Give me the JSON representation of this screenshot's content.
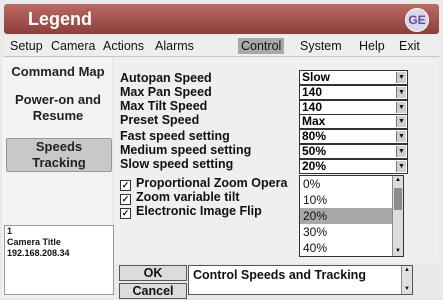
{
  "window": {
    "title": "Legend",
    "logo_text": "GE"
  },
  "menu": [
    "Setup",
    "Camera",
    "Actions",
    "Alarms",
    "Control",
    "System",
    "Help",
    "Exit"
  ],
  "menu_active": "Control",
  "sidebar": {
    "command_map": "Command Map",
    "power_on_1": "Power-on and",
    "power_on_2": "Resume",
    "speeds_1": "Speeds",
    "speeds_2": "Tracking"
  },
  "camera_info": {
    "number": "1",
    "title": "Camera Title",
    "ip": "192.168.208.34"
  },
  "settings": [
    {
      "label": "Autopan Speed",
      "value": "Slow"
    },
    {
      "label": "Max Pan Speed",
      "value": "140"
    },
    {
      "label": "Max Tilt Speed",
      "value": "140"
    },
    {
      "label": "Preset Speed",
      "value": "Max"
    },
    {
      "label": "Fast speed setting",
      "value": "80%"
    },
    {
      "label": "Medium speed setting",
      "value": "50%"
    },
    {
      "label": "Slow speed setting",
      "value": "20%"
    }
  ],
  "checkboxes": [
    {
      "label": "Proportional Zoom Opera",
      "checked": true
    },
    {
      "label": "Zoom variable tilt",
      "checked": true
    },
    {
      "label": "Electronic Image Flip",
      "checked": true
    }
  ],
  "dropdown_open": {
    "options": [
      "0%",
      "10%",
      "20%",
      "30%",
      "40%"
    ],
    "selected": "20%"
  },
  "buttons": {
    "ok": "OK",
    "cancel": "Cancel"
  },
  "status_text": "Control Speeds and Tracking"
}
